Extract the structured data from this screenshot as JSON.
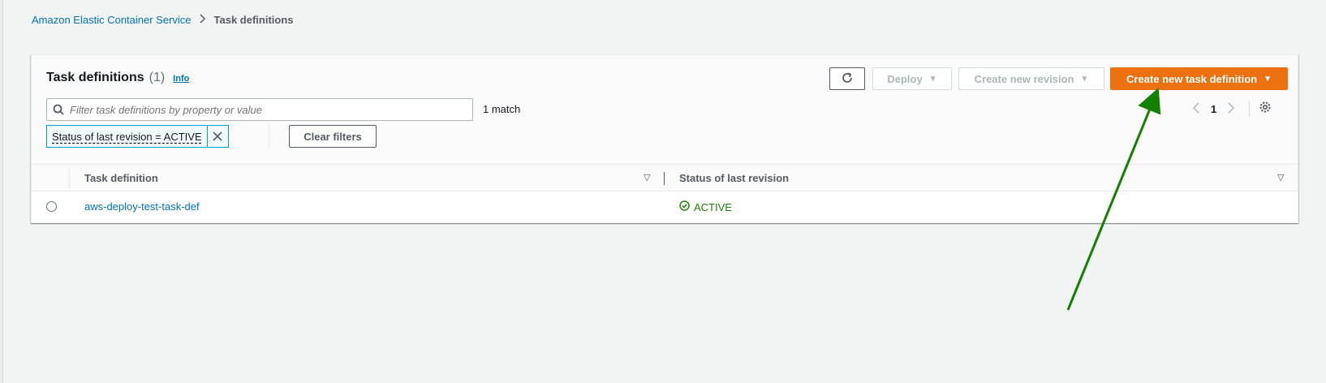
{
  "breadcrumb": {
    "items": [
      "Amazon Elastic Container Service",
      "Task definitions"
    ]
  },
  "panel": {
    "title": "Task definitions",
    "count": "(1)",
    "info_link": "Info"
  },
  "toolbar": {
    "refresh_icon": "refresh-icon",
    "deploy_label": "Deploy",
    "create_revision_label": "Create new revision",
    "create_task_def_label": "Create new task definition"
  },
  "search": {
    "placeholder": "Filter task definitions by property or value",
    "value": "",
    "match_text": "1 match"
  },
  "filter_token": {
    "label": "Status of last revision = ACTIVE"
  },
  "clear_filters_label": "Clear filters",
  "pagination": {
    "current_page": "1"
  },
  "table": {
    "columns": [
      "Task definition",
      "Status of last revision"
    ],
    "rows": [
      {
        "task_definition": "aws-deploy-test-task-def",
        "status": "ACTIVE"
      }
    ]
  },
  "colors": {
    "primary_button": "#ec7211",
    "link": "#0073bb",
    "active_status": "#1d8102",
    "annotation_arrow": "#138000"
  },
  "annotation": {
    "type": "arrow",
    "points_to": "create-task-definition-button"
  }
}
